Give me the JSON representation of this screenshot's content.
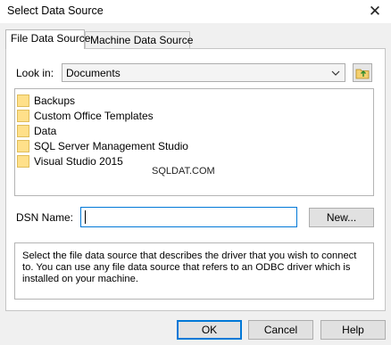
{
  "window": {
    "title": "Select Data Source",
    "close_glyph": "✕"
  },
  "tabs": [
    {
      "label": "File Data Source",
      "active": true
    },
    {
      "label": "Machine Data Source",
      "active": false
    }
  ],
  "lookin": {
    "label": "Look in:",
    "value": "Documents",
    "arrow_icon": "chevron-down-icon",
    "up_folder_icon": "folder-up-icon"
  },
  "files": [
    {
      "label": "Backups",
      "icon": "folder-icon"
    },
    {
      "label": "Custom Office Templates",
      "icon": "folder-icon"
    },
    {
      "label": "Data",
      "icon": "folder-icon"
    },
    {
      "label": "SQL Server Management Studio",
      "icon": "folder-icon"
    },
    {
      "label": "Visual Studio 2015",
      "icon": "folder-icon"
    }
  ],
  "watermark": "SQLDAT.COM",
  "dsn": {
    "label": "DSN Name:",
    "value": "",
    "new_button": "New..."
  },
  "description": "Select the file data source that describes the driver that you wish to connect to. You can use any file data source that refers to an ODBC driver which is installed on your machine.",
  "buttons": {
    "ok": "OK",
    "cancel": "Cancel",
    "help": "Help"
  },
  "colors": {
    "accent": "#0078d7",
    "folder": "#ffe08a",
    "window_bg": "#f0f0f0"
  }
}
